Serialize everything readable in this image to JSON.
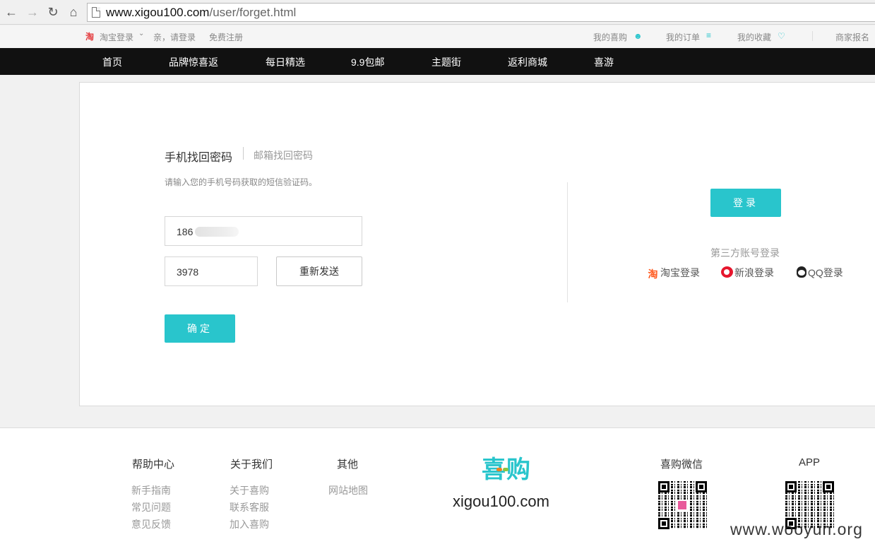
{
  "browser": {
    "url_host": "www.xigou100.com",
    "url_path": "/user/forget.html"
  },
  "topbar": {
    "taobao_login": "淘宝登录",
    "greeting": "亲，请登录",
    "register": "免费注册",
    "my_xigou": "我的喜购",
    "my_orders": "我的订单",
    "my_favorites": "我的收藏",
    "merchant_signup": "商家报名"
  },
  "mainnav": {
    "items": [
      "首页",
      "品牌惊喜返",
      "每日精选",
      "9.9包邮",
      "主题街",
      "返利商城",
      "喜游"
    ]
  },
  "forget": {
    "tab_phone": "手机找回密码",
    "tab_email": "邮箱找回密码",
    "hint": "请输入您的手机号码获取的短信验证码。",
    "phone_value": "186",
    "code_value": "3978",
    "resend_label": "重新发送",
    "confirm_label": "确定"
  },
  "login_side": {
    "login_label": "登录",
    "third_party_title": "第三方账号登录",
    "taobao": "淘宝登录",
    "weibo": "新浪登录",
    "qq": "QQ登录"
  },
  "footer": {
    "help_title": "帮助中心",
    "help_links": [
      "新手指南",
      "常见问题",
      "意见反馈"
    ],
    "about_title": "关于我们",
    "about_links": [
      "关于喜购",
      "联系客服",
      "加入喜购"
    ],
    "other_title": "其他",
    "other_links": [
      "网站地图"
    ],
    "logo_text": "喜购",
    "domain": "xigou100.com",
    "wechat_title": "喜购微信",
    "app_title": "APP"
  },
  "watermark": "www.wooyun.org",
  "colors": {
    "accent": "#29c5cc",
    "nav_bg": "#111111"
  }
}
